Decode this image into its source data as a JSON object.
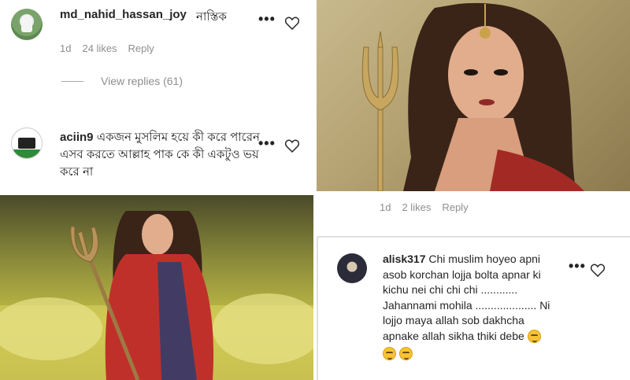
{
  "comment1": {
    "username": "md_nahid_hassan_joy",
    "text": "নাস্তিক",
    "age": "1d",
    "likes": "24 likes",
    "reply": "Reply",
    "view_replies": "View replies (61)"
  },
  "comment2": {
    "username": "aciin9",
    "text": "একজন মুসলিম হয়ে কী করে পারেন এসব করতে আল্লাহ পাক কে কী একটুও ভয় করে না"
  },
  "image_meta": {
    "age": "1d",
    "likes": "2 likes",
    "reply": "Reply"
  },
  "comment3": {
    "username": "alisk317",
    "line1": "Chi muslim hoyeo apni",
    "line2": "asob korchan lojja bolta apnar ki",
    "line3": "kichu nei chi chi chi ............",
    "line4": "Jahannami mohila .................... Ni",
    "line5": "lojjo maya allah sob dakhcha",
    "line6": "apnake allah sikha thiki debe"
  },
  "icons": {
    "more": "more-options-icon",
    "like": "heart-icon",
    "emoji": "smirking-face-emoji"
  },
  "colors": {
    "text": "#262626",
    "muted": "#8e8e8e",
    "saree_red": "#c0302a",
    "gold": "#c9a24a"
  }
}
